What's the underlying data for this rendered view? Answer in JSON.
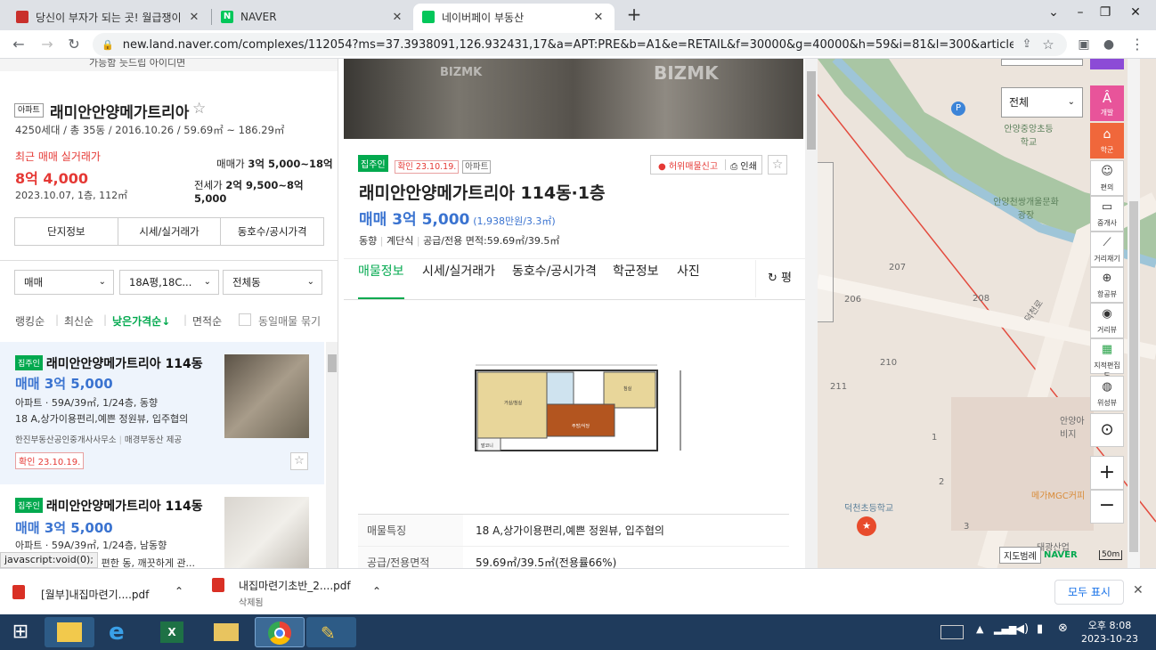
{
  "browser": {
    "tabs": [
      {
        "title": "당신이 부자가 되는 곳! 월급쟁이",
        "favicon_color": "#c9302c"
      },
      {
        "title": "NAVER",
        "favicon_color": "#03c75a"
      },
      {
        "title": "네이버페이 부동산",
        "favicon_color": "#03c75a"
      }
    ],
    "new_tab": "+",
    "url": "new.land.naver.com/complexes/112054?ms=37.3938091,126.932431,17&a=APT:PRE&b=A1&e=RETAIL&f=30000&g=40000&h=59&i=81&l=300&articleNo=23449..."
  },
  "complex": {
    "banner_text": "가능함 듯드립 아이디면",
    "type_badge": "아파트",
    "name": "래미안안양메가트리아",
    "info": "4250세대 / 총 35동 / 2016.10.26 / 59.69㎡ ~ 186.29㎡",
    "recent_label": "최근 매매 실거래가",
    "recent_price": "8억 4,000",
    "recent_detail": "2023.10.07, 1층, 112㎡",
    "sale_range_label": "매매가",
    "sale_range": "3억 5,000~18억",
    "jeonse_label": "전세가",
    "jeonse_range": "2억 9,500~8억 5,000",
    "buttons": [
      "단지정보",
      "시세/실거래가",
      "동호수/공시가격"
    ]
  },
  "filters": {
    "trade": "매매",
    "size": "18A평,18C...",
    "dong": "전체동"
  },
  "sort": {
    "options": [
      "랭킹순",
      "최신순",
      "낮은가격순↓",
      "면적순"
    ],
    "same_listing": "동일매물 묶기"
  },
  "listings": [
    {
      "badge": "집주인",
      "title": "래미안안양메가트리아 114동",
      "price": "매매 3억 5,000",
      "spec": "아파트 · 59A/39㎡, 1/24층, 동향",
      "desc": "18 A,상가이용편리,예쁜 정원뷰, 입주협의",
      "agent": "한진부동산공인중개사사무소",
      "provider": "매경부동산 제공",
      "confirm": "확인 23.10.19."
    },
    {
      "badge": "집주인",
      "title": "래미안안양메가트리아 114동",
      "price": "매매 3억 5,000",
      "spec": "아파트 · 59A/39㎡, 1/24층, 남동향",
      "desc": "방 편한 동, 깨끗하게 관..."
    }
  ],
  "status_link": "javascript:void(0);",
  "detail": {
    "photo_watermark": "BIZMK",
    "badge_owner": "집주인",
    "confirm": "확인 23.10.19.",
    "type": "아파트",
    "report": "허위매물신고",
    "print": "인쇄",
    "title": "래미안안양메가트리아 114동·1층",
    "price": "매매 3억 5,000",
    "price_per": "(1,938만원/3.3㎡)",
    "meta": [
      "동향",
      "계단식",
      "공급/전용 면적:59.69㎡/39.5㎡"
    ],
    "tabs": [
      "매물정보",
      "시세/실거래가",
      "동호수/공시가격",
      "학군정보",
      "사진"
    ],
    "pyeong": "평",
    "floorplan_rooms": [
      "거실/침실",
      "주방/식당",
      "침실",
      "발코니"
    ],
    "rows": [
      {
        "k": "매물특징",
        "v": "18 A,상가이용편리,예쁜 정원뷰, 입주협의"
      },
      {
        "k": "공급/전용면적",
        "v": "59.69㎡/39.5㎡(전용률66%)"
      }
    ]
  },
  "map": {
    "filter": "전체",
    "labels": [
      "안양중앙초등학교",
      "안양천쌍개울문화광장",
      "207",
      "206",
      "208",
      "210",
      "211",
      "1",
      "2",
      "3",
      "안양아비지",
      "덕천로",
      "덕천초등학교",
      "메가MGC커피",
      "태광산업"
    ],
    "tools": [
      "개발",
      "학군",
      "편의",
      "중개사",
      "거리재기",
      "항공뷰",
      "거리뷰",
      "지적편집도",
      "위성뷰"
    ],
    "scale": "50m",
    "brand": "NAVER",
    "legend": "지도범례"
  },
  "downloads": [
    {
      "name": "[월부]내집마련기....pdf",
      "status": ""
    },
    {
      "name": "내집마련기초반_2....pdf",
      "status": "삭제됨"
    }
  ],
  "download_show_all": "모두 표시",
  "clock": {
    "time": "오후 8:08",
    "date": "2023-10-23"
  }
}
